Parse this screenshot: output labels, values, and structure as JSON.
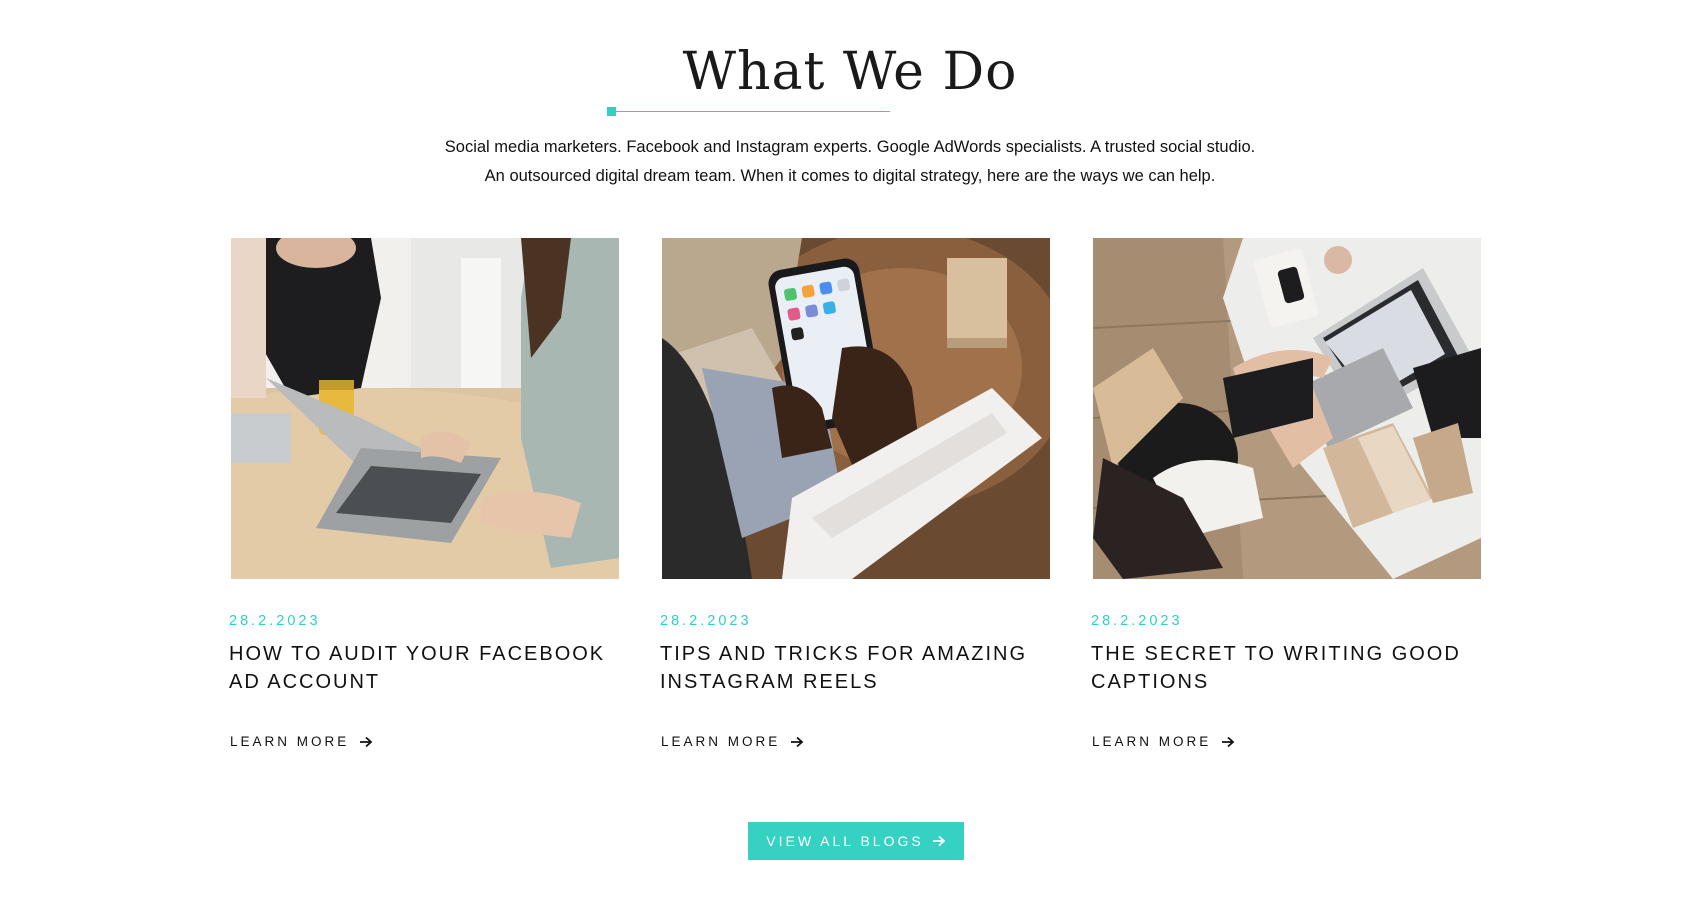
{
  "section": {
    "title": "What We Do",
    "intro_line_1": "Social media marketers. Facebook and Instagram experts. Google AdWords specialists. A trusted social studio.",
    "intro_line_2": "An outsourced digital dream team. When it comes to digital strategy, here are the ways we can help.",
    "accent_color": "#2fd1c4"
  },
  "cards": [
    {
      "date": "28.2.2023",
      "title": "How to audit your Facebook Ad account",
      "link_label": "LEARN MORE",
      "image": "photo-women-working-on-laptop-at-table"
    },
    {
      "date": "28.2.2023",
      "title": "Tips and tricks for amazing Instagram reels",
      "link_label": "LEARN MORE",
      "image": "photo-hands-holding-smartphone"
    },
    {
      "date": "28.2.2023",
      "title": "The secret to writing good captions",
      "link_label": "LEARN MORE",
      "image": "photo-woman-typing-at-desk-overhead"
    }
  ],
  "footer": {
    "button_label": "VIEW ALL BLOGS",
    "button_color": "#35d2c4"
  },
  "icons": {
    "link_arrow": "arrow-right-icon"
  }
}
